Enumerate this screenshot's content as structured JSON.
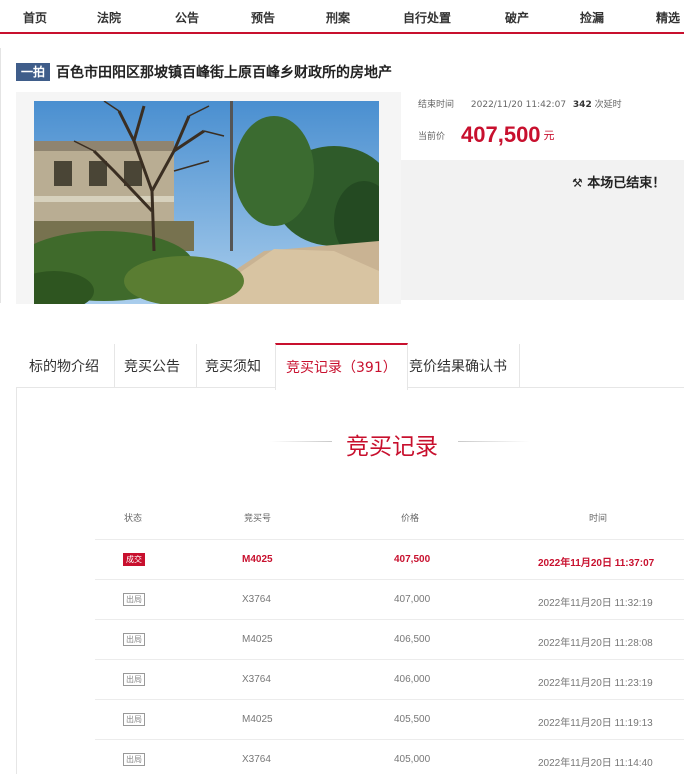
{
  "nav": {
    "items": [
      "首页",
      "法院",
      "公告",
      "预告",
      "刑案",
      "自行处置",
      "破产",
      "捡漏",
      "精选"
    ]
  },
  "lot": {
    "badge": "一拍",
    "title": "百色市田阳区那坡镇百峰街上原百峰乡财政所的房地产"
  },
  "info": {
    "end_label": "结束时间",
    "end_time": "2022/11/20 11:42:07",
    "delay_count": "342",
    "delay_label": "次延时",
    "price_label": "当前价",
    "price_value": "407,500",
    "price_unit": "元",
    "ended_text": "本场已结束！"
  },
  "tabs": [
    {
      "label": "标的物介绍"
    },
    {
      "label": "竞买公告"
    },
    {
      "label": "竞买须知"
    },
    {
      "label": "竞买记录（391）"
    },
    {
      "label": "竞价结果确认书"
    }
  ],
  "active_tab": 3,
  "bids": {
    "section_title": "竞买记录",
    "headers": {
      "status": "状态",
      "bidder": "竞买号",
      "price": "价格",
      "time": "时间"
    },
    "rows": [
      {
        "status": "成交",
        "bidder": "M4025",
        "price": "407,500",
        "time": "2022年11月20日 11:37:07",
        "winning": true
      },
      {
        "status": "出局",
        "bidder": "X3764",
        "price": "407,000",
        "time": "2022年11月20日 11:32:19",
        "winning": false
      },
      {
        "status": "出局",
        "bidder": "M4025",
        "price": "406,500",
        "time": "2022年11月20日 11:28:08",
        "winning": false
      },
      {
        "status": "出局",
        "bidder": "X3764",
        "price": "406,000",
        "time": "2022年11月20日 11:23:19",
        "winning": false
      },
      {
        "status": "出局",
        "bidder": "M4025",
        "price": "405,500",
        "time": "2022年11月20日 11:19:13",
        "winning": false
      },
      {
        "status": "出局",
        "bidder": "X3764",
        "price": "405,000",
        "time": "2022年11月20日 11:14:40",
        "winning": false
      }
    ]
  },
  "colors": {
    "accent": "#c8102e",
    "badge": "#3f5d8a"
  }
}
